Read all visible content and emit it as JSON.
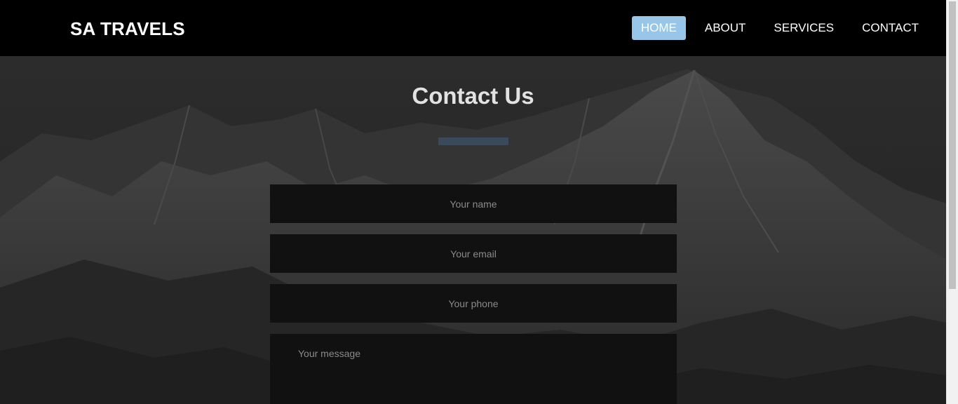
{
  "header": {
    "brand": "SA TRAVELS",
    "nav": [
      {
        "label": "HOME",
        "active": true
      },
      {
        "label": "ABOUT",
        "active": false
      },
      {
        "label": "SERVICES",
        "active": false
      },
      {
        "label": "CONTACT",
        "active": false
      }
    ]
  },
  "contact": {
    "title": "Contact Us",
    "name_placeholder": "Your name",
    "email_placeholder": "Your email",
    "phone_placeholder": "Your phone",
    "message_placeholder": "Your message"
  },
  "colors": {
    "navbar": "#000000",
    "active_nav": "#98c6e8",
    "underline": "#3b4a5a",
    "field_bg": "#111111"
  }
}
